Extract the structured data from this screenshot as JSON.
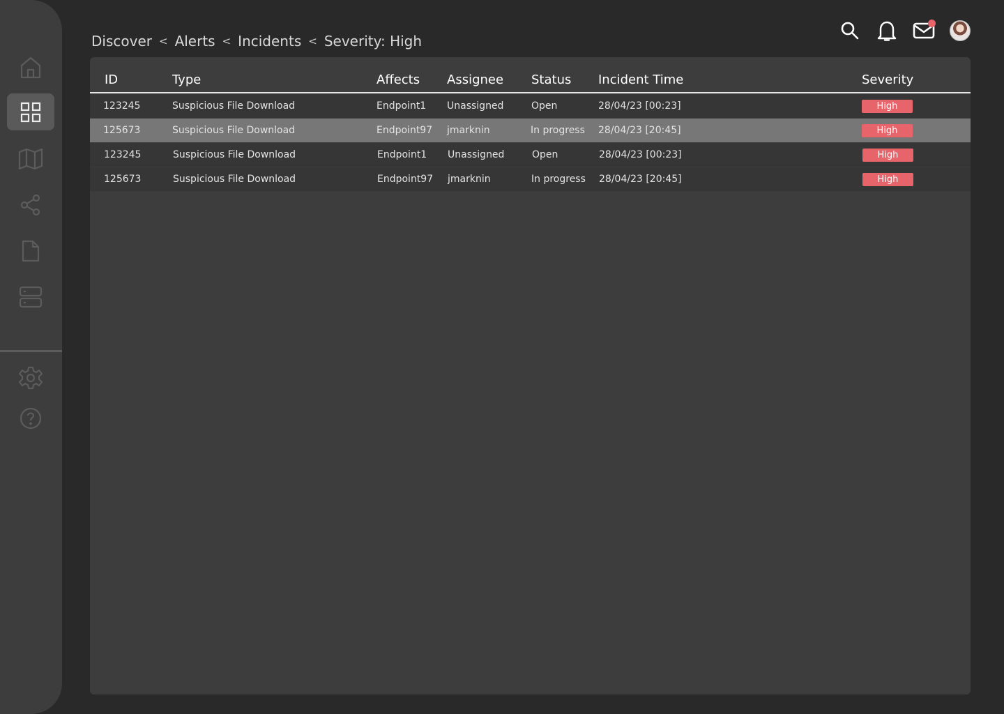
{
  "breadcrumb": {
    "items": [
      "Discover",
      "Alerts",
      "Incidents",
      "Severity: High"
    ],
    "separator": "<"
  },
  "sidebar": {
    "items": [
      {
        "icon": "home-icon"
      },
      {
        "icon": "dashboard-grid-icon",
        "active": true
      },
      {
        "icon": "map-icon"
      },
      {
        "icon": "share-icon"
      },
      {
        "icon": "document-icon"
      },
      {
        "icon": "server-icon"
      }
    ],
    "bottom_items": [
      {
        "icon": "gear-icon"
      },
      {
        "icon": "help-icon"
      }
    ]
  },
  "topbar": {
    "icons": [
      "search-icon",
      "bell-icon",
      "mail-icon",
      "avatar"
    ]
  },
  "colors": {
    "background": "#292929",
    "panel": "#3d3d3d",
    "selected_row": "#777777",
    "severity_high": "#e8646b",
    "notification": "#e8646b"
  },
  "table": {
    "headers": {
      "id": "ID",
      "type": "Type",
      "affects": "Affects",
      "assignee": "Assignee",
      "status": "Status",
      "time": "Incident Time",
      "severity": "Severity"
    },
    "rows": [
      {
        "id": "123245",
        "type": "Suspicious File Download",
        "affects": "Endpoint1",
        "assignee": "Unassigned",
        "status": "Open",
        "time": "28/04/23 [00:23]",
        "severity": "High"
      },
      {
        "id": "125673",
        "type": "Suspicious File Download",
        "affects": "Endpoint97",
        "assignee": "jmarknin",
        "status": "In progress",
        "time": "28/04/23 [20:45]",
        "severity": "High",
        "selected": true
      },
      {
        "id": "123245",
        "type": "Suspicious File Download",
        "affects": "Endpoint1",
        "assignee": "Unassigned",
        "status": "Open",
        "time": "28/04/23 [00:23]",
        "severity": "High"
      },
      {
        "id": "125673",
        "type": "Suspicious File Download",
        "affects": "Endpoint97",
        "assignee": "jmarknin",
        "status": "In progress",
        "time": "28/04/23 [20:45]",
        "severity": "High"
      }
    ]
  }
}
